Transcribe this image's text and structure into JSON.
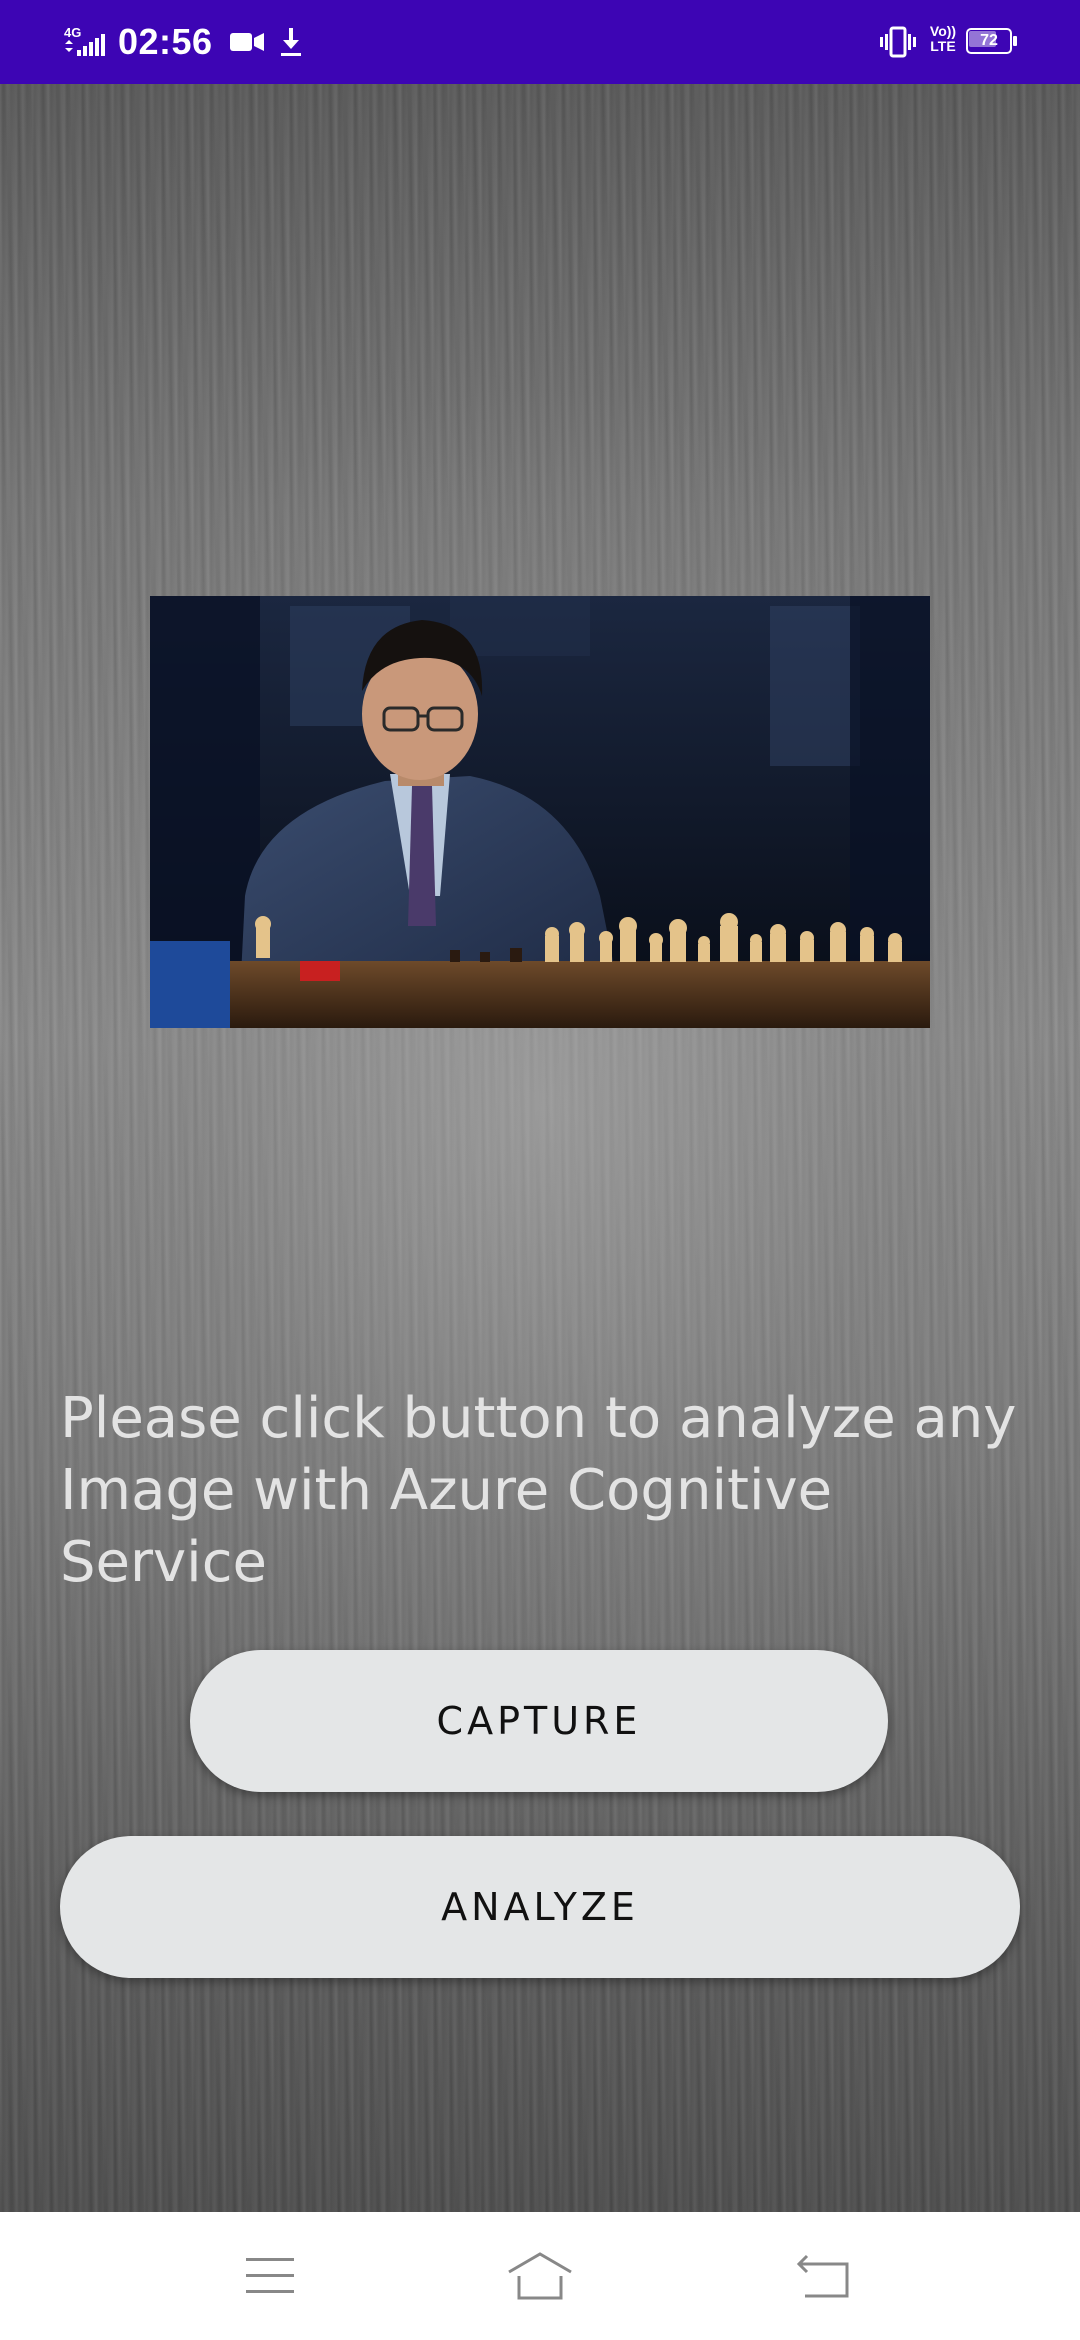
{
  "status_bar": {
    "network": "4G",
    "time": "02:56",
    "volte_top": "Vo))",
    "volte_bottom": "LTE",
    "battery_level": 72,
    "battery_text": "72",
    "background_color": "#3d05b4"
  },
  "main": {
    "photo_alt": "Chess player seated at a chessboard",
    "prompt": "Please click button to analyze any Image with Azure Cognitive Service",
    "capture_label": "CAPTURE",
    "analyze_label": "ANALYZE"
  },
  "nav_bar": {
    "icons": [
      "menu-icon",
      "home-icon",
      "back-icon"
    ]
  }
}
